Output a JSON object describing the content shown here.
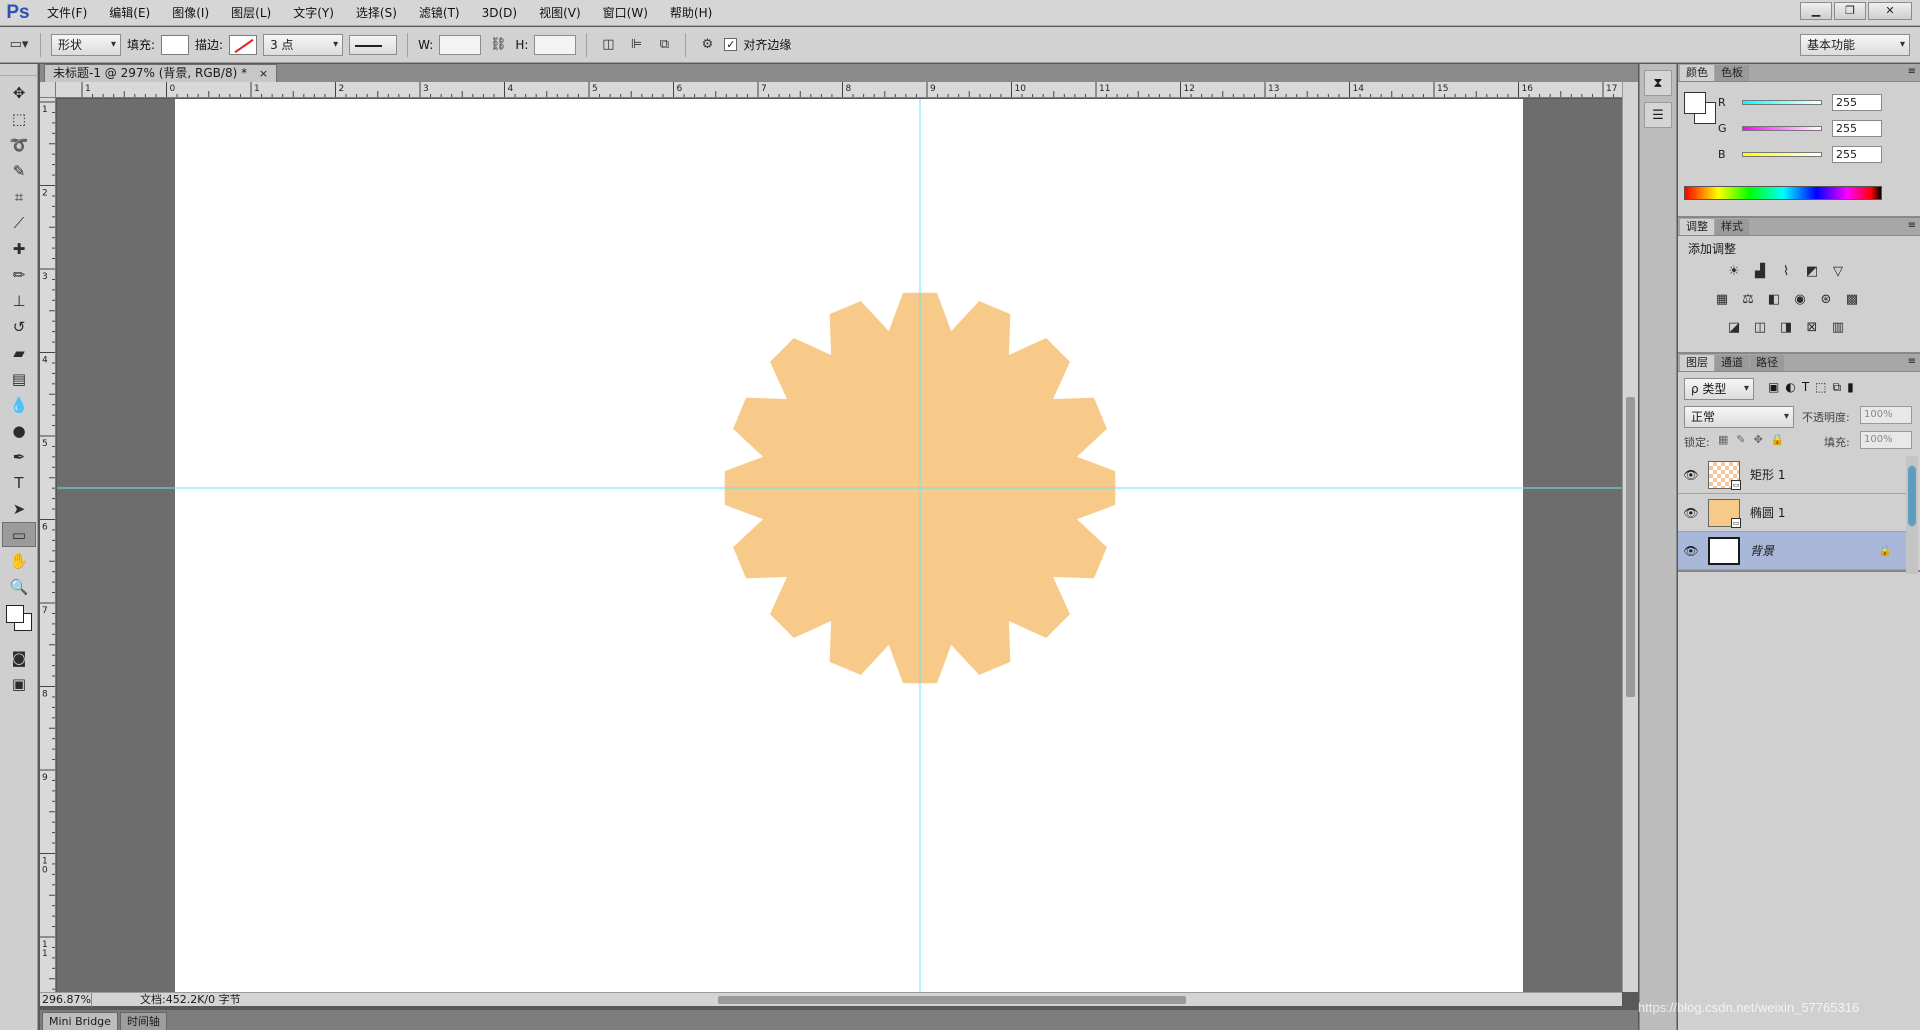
{
  "app": {
    "logo": "Ps"
  },
  "menu": [
    "文件(F)",
    "编辑(E)",
    "图像(I)",
    "图层(L)",
    "文字(Y)",
    "选择(S)",
    "滤镜(T)",
    "3D(D)",
    "视图(V)",
    "窗口(W)",
    "帮助(H)"
  ],
  "window_controls": {
    "minimize": "▁",
    "restore": "❐",
    "close": "✕"
  },
  "options": {
    "mode": "形状",
    "fill_label": "填充:",
    "stroke_label": "描边:",
    "stroke_width": "3 点",
    "w_label": "W:",
    "h_label": "H:",
    "align_edges_label": "对齐边缘",
    "align_edges_checked": "✓",
    "workspace": "基本功能"
  },
  "document": {
    "tab_title": "未标题-1 @ 297% (背景, RGB/8) *",
    "close": "×",
    "zoom": "296.87%",
    "doc_info": "文档:452.2K/0 字节"
  },
  "ruler": {
    "top_labels": [
      "1",
      "0",
      "1",
      "2",
      "3",
      "4",
      "5",
      "6",
      "7",
      "8",
      "9",
      "10",
      "11",
      "12",
      "13",
      "14",
      "15",
      "16",
      "17"
    ],
    "left_labels": [
      "1",
      "2",
      "3",
      "4",
      "5",
      "6",
      "7",
      "8",
      "9",
      "10",
      "11"
    ]
  },
  "canvas": {
    "shape_color": "#f7ca89",
    "guide_color": "#6fe6ee",
    "gear_teeth": 16
  },
  "bottom_tabs": [
    "Mini Bridge",
    "时间轴"
  ],
  "panels": {
    "color": {
      "tabs": [
        "颜色",
        "色板"
      ],
      "r_label": "R",
      "g_label": "G",
      "b_label": "B",
      "r": "255",
      "g": "255",
      "b": "255"
    },
    "adjustments": {
      "tabs": [
        "调整",
        "样式"
      ],
      "title": "添加调整"
    },
    "layers": {
      "tabs": [
        "图层",
        "通道",
        "路径"
      ],
      "filter": "ρ 类型",
      "blend_mode": "正常",
      "opacity_label": "不透明度:",
      "opacity": "100%",
      "lock_label": "锁定:",
      "fill_label": "填充:",
      "fill": "100%",
      "items": [
        {
          "name": "矩形 1",
          "visible": "👁"
        },
        {
          "name": "椭圆 1",
          "visible": "👁"
        },
        {
          "name": "背景",
          "visible": "👁"
        }
      ]
    }
  },
  "watermark": "https://blog.csdn.net/weixin_57765316"
}
